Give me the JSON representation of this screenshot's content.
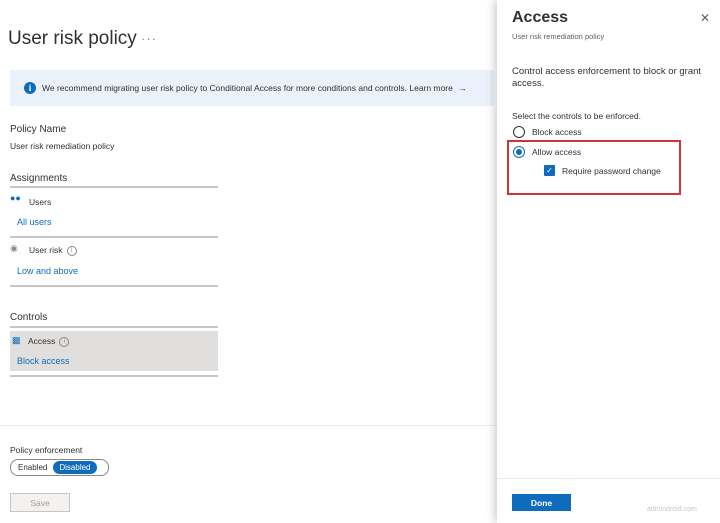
{
  "page": {
    "title": "User risk policy",
    "more_label": "···"
  },
  "banner": {
    "icon": "info-icon",
    "text": "We recommend migrating user risk policy to Conditional Access for more conditions and controls. Learn more",
    "arrow": "→"
  },
  "policy": {
    "name_label": "Policy Name",
    "name_value": "User risk remediation policy"
  },
  "assignments": {
    "heading": "Assignments",
    "users": {
      "icon": "users-icon",
      "label": "Users",
      "value": "All users"
    },
    "user_risk": {
      "icon": "user-risk-icon",
      "label": "User risk",
      "help": "i",
      "value": "Low and above"
    }
  },
  "controls": {
    "heading": "Controls",
    "access": {
      "icon": "access-icon",
      "label": "Access",
      "help": "i",
      "value": "Block access"
    }
  },
  "enforcement": {
    "label": "Policy enforcement",
    "options": [
      "Enabled",
      "Disabled"
    ],
    "selected": "Disabled"
  },
  "save_label": "Save",
  "panel": {
    "title": "Access",
    "subtitle": "User risk remediation policy",
    "close": "✕",
    "description": "Control access enforcement to block or grant access.",
    "instruction": "Select the controls to be enforced.",
    "radio_options": [
      {
        "label": "Block access",
        "selected": false
      },
      {
        "label": "Allow access",
        "selected": true
      }
    ],
    "checkbox": {
      "label": "Require password change",
      "checked": true,
      "mark": "✓"
    },
    "done_label": "Done",
    "watermark": "admindroid.com"
  },
  "colors": {
    "accent": "#0f6cbd",
    "highlight": "#d13438",
    "banner_bg": "#eaf1fb"
  }
}
